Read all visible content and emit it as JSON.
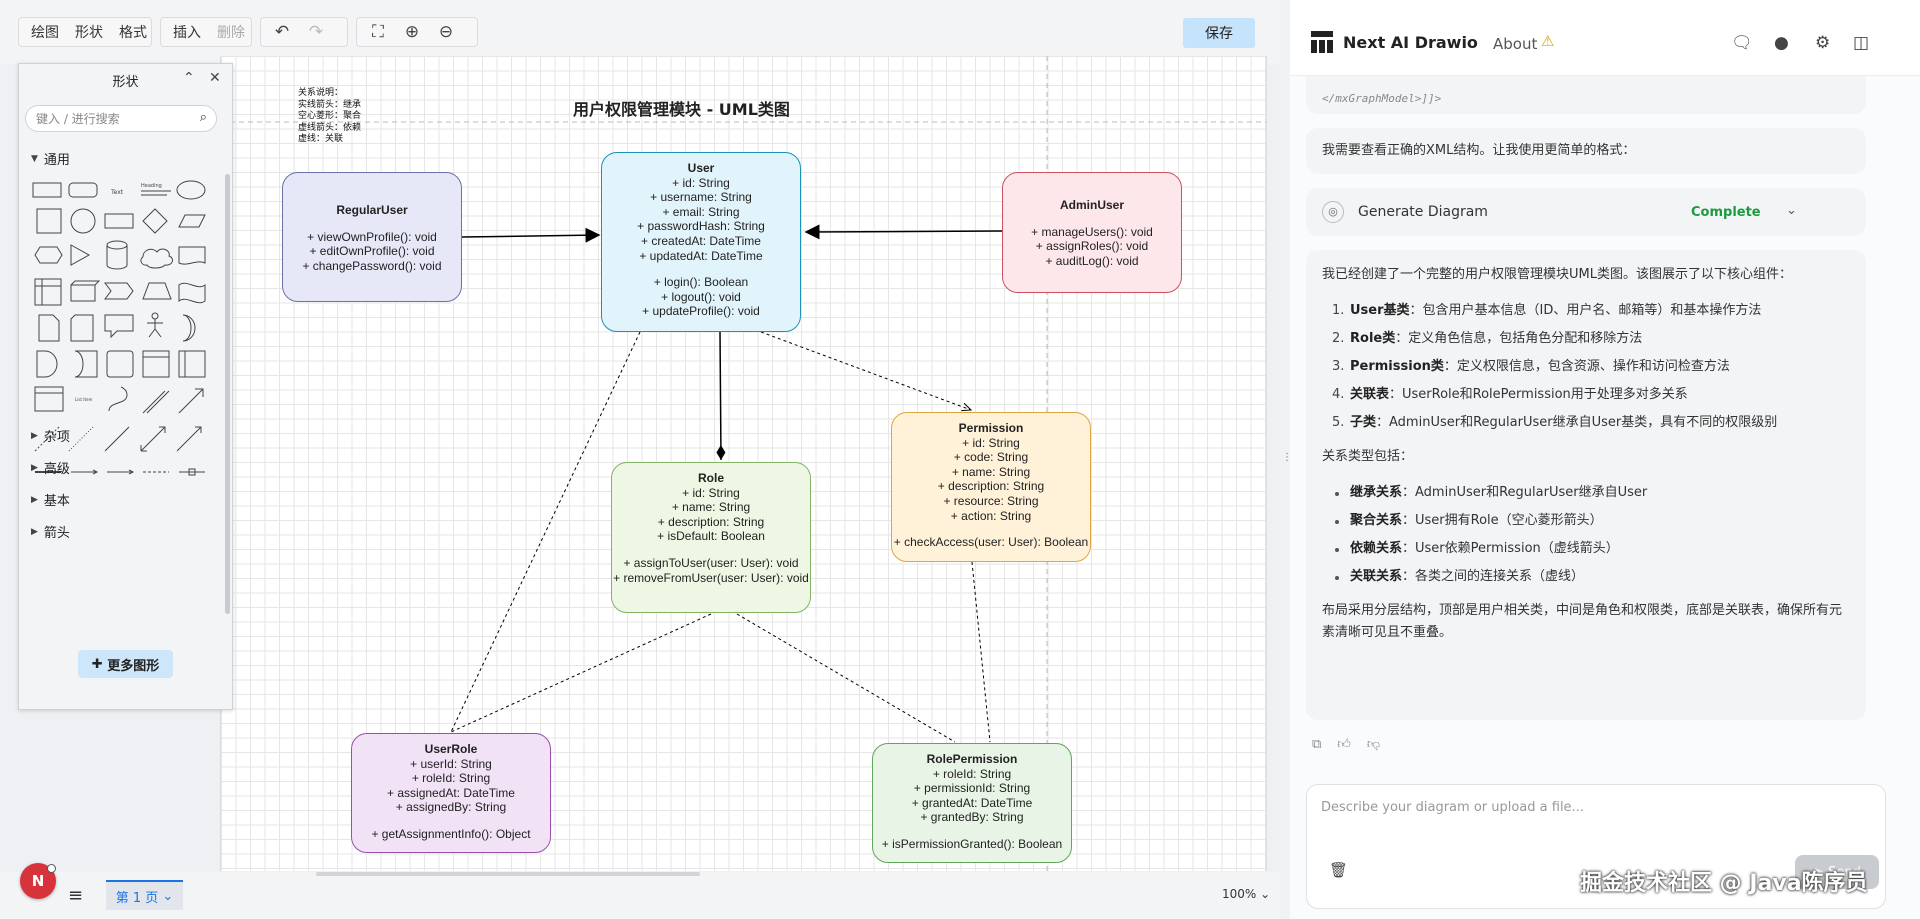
{
  "toolbar": {
    "menu": [
      "绘图",
      "形状",
      "格式"
    ],
    "insert": "插入",
    "delete": "删除",
    "save": "保存"
  },
  "shapes_panel": {
    "title": "形状",
    "search_placeholder": "键入 / 进行搜索",
    "general": "通用",
    "sections": [
      "杂项",
      "高级",
      "基本",
      "箭头"
    ],
    "more_shapes": "更多图形"
  },
  "diagram": {
    "title": "用户权限管理模块 - UML类图",
    "legend": [
      "关系说明：",
      "实线箭头：继承",
      "空心菱形：聚合",
      "虚线箭头：依赖",
      "虚线：关联"
    ],
    "classes": {
      "user": {
        "name": "User",
        "attrs": [
          "+ id: String",
          "+ username: String",
          "+ email: String",
          "+ passwordHash: String",
          "+ createdAt: DateTime",
          "+ updatedAt: DateTime"
        ],
        "methods": [
          "+ login(): Boolean",
          "+ logout(): void",
          "+ updateProfile(): void"
        ]
      },
      "regular": {
        "name": "RegularUser",
        "attrs": [],
        "methods": [
          "+ viewOwnProfile(): void",
          "+ editOwnProfile(): void",
          "+ changePassword(): void"
        ]
      },
      "admin": {
        "name": "AdminUser",
        "attrs": [],
        "methods": [
          "+ manageUsers(): void",
          "+ assignRoles(): void",
          "+ auditLog(): void"
        ]
      },
      "role": {
        "name": "Role",
        "attrs": [
          "+ id: String",
          "+ name: String",
          "+ description: String",
          "+ isDefault: Boolean"
        ],
        "methods": [
          "+ assignToUser(user: User): void",
          "+ removeFromUser(user: User): void"
        ]
      },
      "permission": {
        "name": "Permission",
        "attrs": [
          "+ id: String",
          "+ code: String",
          "+ name: String",
          "+ description: String",
          "+ resource: String",
          "+ action: String"
        ],
        "methods": [
          "+ checkAccess(user: User): Boolean"
        ]
      },
      "userrole": {
        "name": "UserRole",
        "attrs": [
          "+ userId: String",
          "+ roleId: String",
          "+ assignedAt: DateTime",
          "+ assignedBy: String"
        ],
        "methods": [
          "+ getAssignmentInfo(): Object"
        ]
      },
      "roleperm": {
        "name": "RolePermission",
        "attrs": [
          "+ roleId: String",
          "+ permissionId: String",
          "+ grantedAt: DateTime",
          "+ grantedBy: String"
        ],
        "methods": [
          "+ isPermissionGranted(): Boolean"
        ]
      }
    }
  },
  "bottom": {
    "avatar": "N",
    "page_tab": "第 1 页",
    "zoom": "100%"
  },
  "chat": {
    "app_title": "Next AI Drawio",
    "about": "About",
    "xml_snippet": "</mxGraphModel>]]>",
    "msg1": "我需要查看正确的XML结构。让我使用更简单的格式：",
    "tool": {
      "label": "Generate Diagram",
      "status": "Complete"
    },
    "intro": "我已经创建了一个完整的用户权限管理模块UML类图。该图展示了以下核心组件：",
    "components": [
      {
        "num": "1.",
        "title": "User基类",
        "text": "：包含用户基本信息（ID、用户名、邮箱等）和基本操作方法"
      },
      {
        "num": "2.",
        "title": "Role类",
        "text": "：定义角色信息，包括角色分配和移除方法"
      },
      {
        "num": "3.",
        "title": "Permission类",
        "text": "：定义权限信息，包含资源、操作和访问检查方法"
      },
      {
        "num": "4.",
        "title": "关联表",
        "text": "：UserRole和RolePermission用于处理多对多关系"
      },
      {
        "num": "5.",
        "title": "子类",
        "text": "：AdminUser和RegularUser继承自User基类，具有不同的权限级别"
      }
    ],
    "rel_intro": "关系类型包括：",
    "relations": [
      {
        "title": "继承关系",
        "text": "：AdminUser和RegularUser继承自User"
      },
      {
        "title": "聚合关系",
        "text": "：User拥有Role（空心菱形箭头）"
      },
      {
        "title": "依赖关系",
        "text": "：User依赖Permission（虚线箭头）"
      },
      {
        "title": "关联关系",
        "text": "：各类之间的连接关系（虚线）"
      }
    ],
    "summary": "布局采用分层结构，顶部是用户相关类，中间是角色和权限类，底部是关联表，确保所有元素清晰可见且不重叠。",
    "input_placeholder": "Describe your diagram or upload a file...",
    "send": "Send",
    "watermark": "掘金技术社区 @ Java陈序员"
  },
  "colors": {
    "user": "#e2f4fb",
    "user_border": "#1e8fb5",
    "regular": "#e6e8f7",
    "regular_border": "#6c72a8",
    "admin": "#fde7ea",
    "admin_border": "#c9545f",
    "role": "#eef7e3",
    "role_border": "#82b366",
    "permission": "#fff2d9",
    "permission_border": "#e0a540",
    "userrole": "#f2e2f6",
    "userrole_border": "#9b4fad",
    "roleperm": "#e8f5e6",
    "roleperm_border": "#5fa55a"
  }
}
